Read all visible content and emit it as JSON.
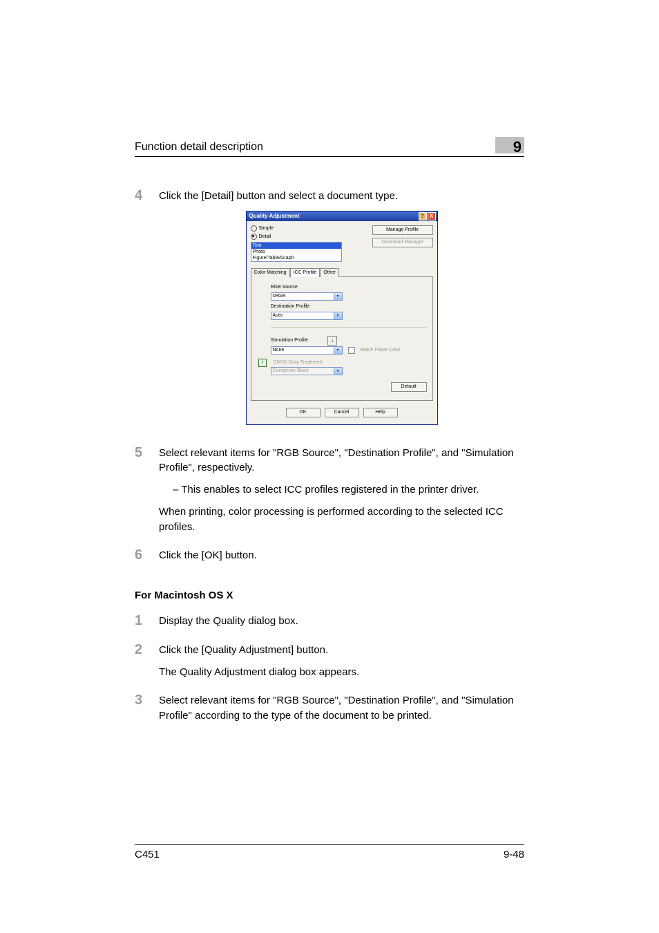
{
  "header": {
    "title": "Function detail description",
    "chapter": "9"
  },
  "steps_a": [
    {
      "n": "4",
      "text": "Click the [Detail] button and select a document type."
    }
  ],
  "dialog": {
    "title": "Quality Adjustment",
    "help_btn": "?",
    "close_btn": "X",
    "radio_simple": "Simple",
    "radio_detail": "Detail",
    "btn_manage": "Manage Profile",
    "btn_download": "Download Manager",
    "types": {
      "t0": "Text",
      "t1": "Photo",
      "t2": "Figure/Table/Graph"
    },
    "tab0": "Color Matching",
    "tab1": "ICC Profile",
    "tab2": "Other",
    "lbl_rgb": "RGB Source",
    "val_rgb": "sRGB",
    "lbl_dest": "Destination Profile",
    "val_dest": "Auto",
    "lbl_sim": "Simulation Profile",
    "val_sim": "None",
    "download_icon": "↓",
    "chk_match": "Match Paper Color",
    "info_icon": "i",
    "lbl_cmyk": "CMYK Gray Treatment",
    "val_cmyk": "Composite Black",
    "btn_default": "Default",
    "btn_ok": "OK",
    "btn_cancel": "Cancel",
    "btn_help": "Help"
  },
  "steps_b": {
    "s5_n": "5",
    "s5_a": "Select relevant items for \"RGB Source\", \"Destination Profile\", and \"Simulation Profile\", respectively.",
    "s5_b": "–   This enables to select ICC profiles registered in the printer driver.",
    "s5_c": "When printing, color processing is performed according to the selected ICC profiles.",
    "s6_n": "6",
    "s6_a": "Click the [OK] button."
  },
  "mac_heading": "For Macintosh OS X",
  "steps_c": {
    "s1_n": "1",
    "s1_a": "Display the Quality dialog box.",
    "s2_n": "2",
    "s2_a": "Click the [Quality Adjustment] button.",
    "s2_b": "The Quality Adjustment dialog box appears.",
    "s3_n": "3",
    "s3_a": "Select relevant items for \"RGB Source\", \"Destination Profile\", and \"Simulation Profile\" according to the type of the document to be printed."
  },
  "footer": {
    "left": "C451",
    "right": "9-48"
  }
}
